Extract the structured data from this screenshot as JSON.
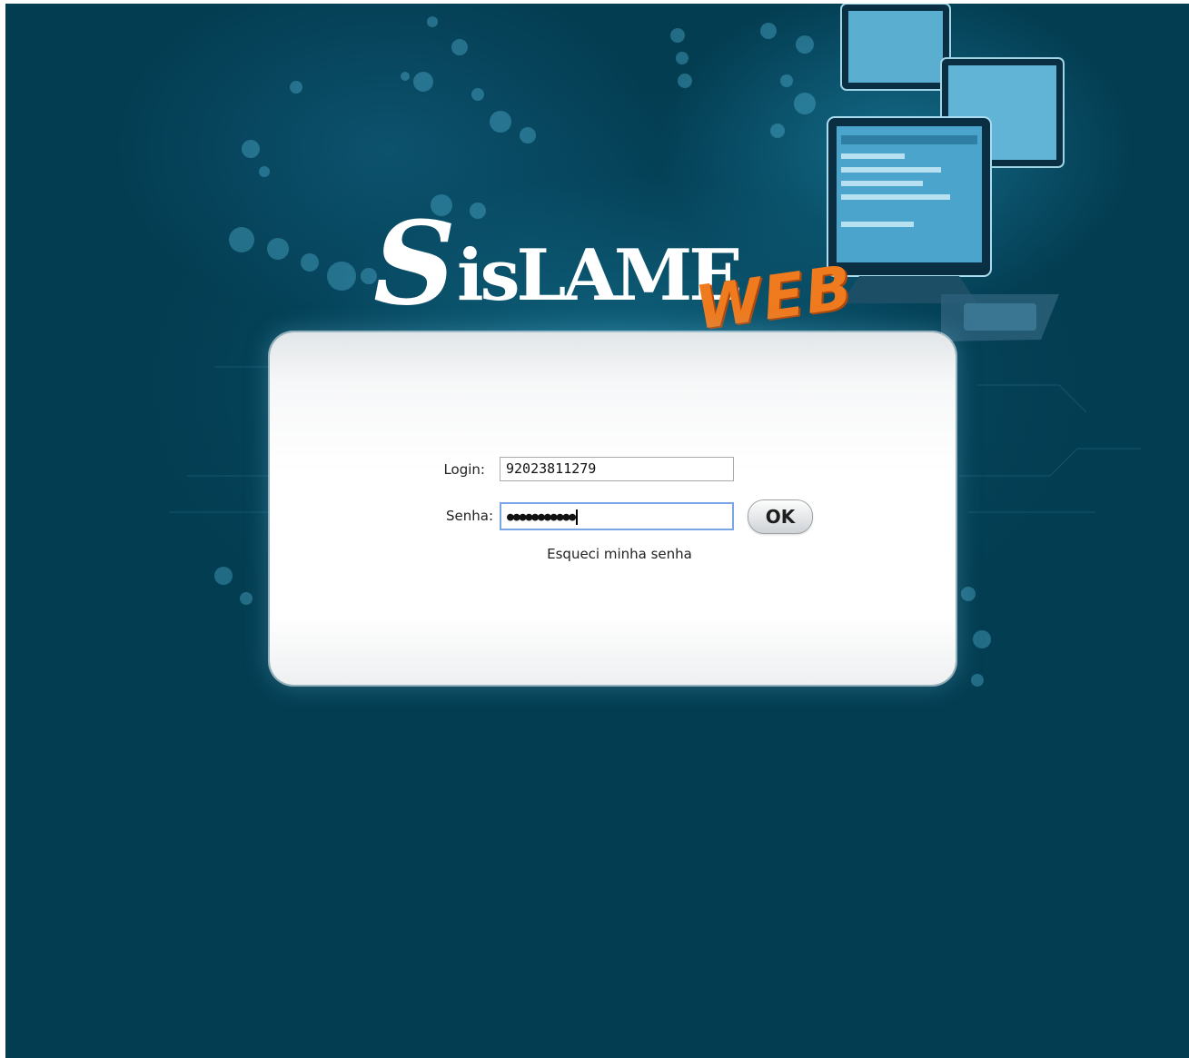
{
  "brand": {
    "logo_main": "SisLAME",
    "logo_accent": "WEB",
    "background_color": "#033d52",
    "accent_color": "#f07a1e"
  },
  "login_form": {
    "login_label": "Login:",
    "login_value": "92023811279",
    "senha_label": "Senha:",
    "senha_value_masked": "●●●●●●●●●●●",
    "ok_label": "OK",
    "forgot_password_label": "Esqueci minha senha"
  }
}
